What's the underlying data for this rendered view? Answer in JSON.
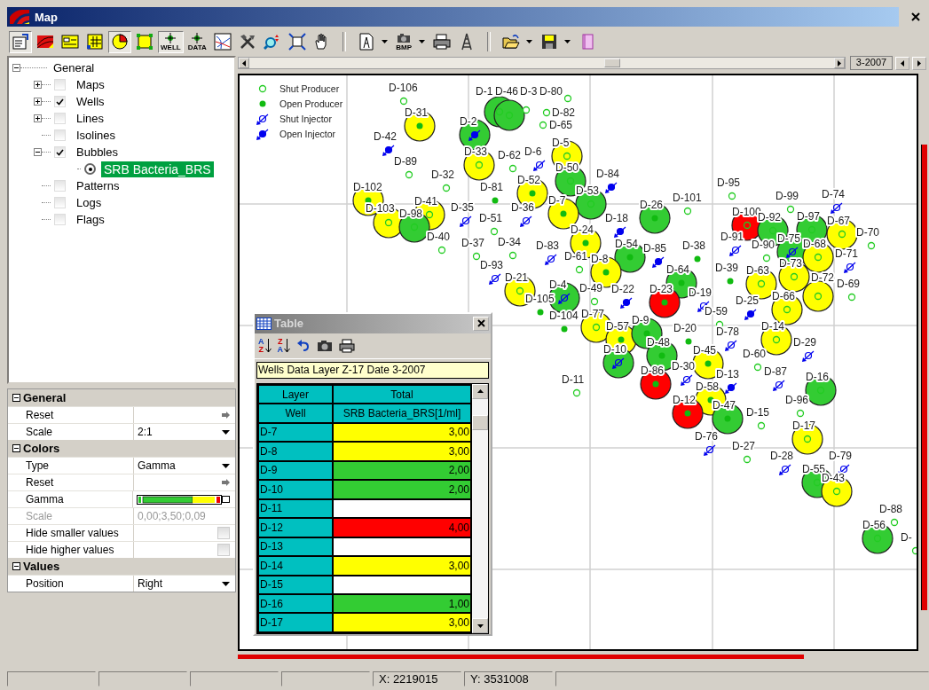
{
  "window": {
    "title": "Map"
  },
  "toolbar": {
    "groups": [
      {
        "buttons": [
          {
            "kind": "properties",
            "pressed": true,
            "menu": false
          },
          {
            "kind": "map-layers",
            "pressed": false,
            "menu": false
          },
          {
            "kind": "legend",
            "pressed": false,
            "menu": false
          },
          {
            "kind": "grid",
            "pressed": false,
            "menu": false
          },
          {
            "kind": "pie",
            "pressed": true,
            "menu": false
          },
          {
            "kind": "select",
            "pressed": false,
            "menu": false
          },
          {
            "kind": "well",
            "label": "WELL",
            "pressed": true,
            "menu": false
          },
          {
            "kind": "data",
            "label": "DATA",
            "pressed": false,
            "menu": false
          },
          {
            "kind": "crossplot",
            "pressed": false,
            "menu": false
          },
          {
            "kind": "tools",
            "pressed": false,
            "menu": false
          },
          {
            "kind": "zoom",
            "pressed": false,
            "menu": false
          },
          {
            "kind": "fit",
            "pressed": false,
            "menu": false
          },
          {
            "kind": "pan",
            "pressed": false,
            "menu": false
          }
        ]
      },
      {
        "buttons": [
          {
            "kind": "document",
            "pressed": false,
            "menu": true
          },
          {
            "kind": "bmp",
            "label": "BMP",
            "pressed": false,
            "menu": true
          },
          {
            "kind": "print",
            "pressed": false,
            "menu": false
          },
          {
            "kind": "rig",
            "pressed": false,
            "menu": false
          }
        ]
      },
      {
        "buttons": [
          {
            "kind": "open",
            "pressed": false,
            "menu": true
          },
          {
            "kind": "save",
            "pressed": false,
            "menu": true
          },
          {
            "kind": "book",
            "pressed": false,
            "menu": false
          }
        ]
      }
    ]
  },
  "tree": {
    "label": "General",
    "expanded": true,
    "children": [
      {
        "label": "Maps",
        "kind": "checkbox",
        "checked": false,
        "expanded": false
      },
      {
        "label": "Wells",
        "kind": "checkbox",
        "checked": true,
        "expanded": false
      },
      {
        "label": "Lines",
        "kind": "checkbox",
        "checked": false,
        "expanded": false
      },
      {
        "label": "Isolines",
        "kind": "checkbox",
        "checked": false
      },
      {
        "label": "Bubbles",
        "kind": "checkbox",
        "checked": true,
        "expanded": true,
        "children": [
          {
            "label": "SRB Bacteria_BRS",
            "kind": "radio",
            "selected": true
          }
        ]
      },
      {
        "label": "Patterns",
        "kind": "checkbox",
        "checked": false
      },
      {
        "label": "Logs",
        "kind": "checkbox",
        "checked": false
      },
      {
        "label": "Flags",
        "kind": "checkbox",
        "checked": false
      }
    ]
  },
  "properties": [
    {
      "title": "General",
      "expanded": true,
      "rows": [
        {
          "name": "Reset",
          "kind": "action",
          "disabled": false
        },
        {
          "name": "Scale",
          "kind": "dropdown",
          "value": "2:1",
          "disabled": false
        }
      ]
    },
    {
      "title": "Colors",
      "expanded": true,
      "rows": [
        {
          "name": "Type",
          "kind": "dropdown",
          "value": "Gamma",
          "disabled": false
        },
        {
          "name": "Reset",
          "kind": "action",
          "disabled": false
        },
        {
          "name": "Gamma",
          "kind": "gamma",
          "disabled": false
        },
        {
          "name": "Scale",
          "kind": "text",
          "value": "0,00;3,50;0,09",
          "disabled": true
        },
        {
          "name": "Hide smaller values",
          "kind": "checkbox",
          "checked": false,
          "disabled": false
        },
        {
          "name": "Hide higher values",
          "kind": "checkbox",
          "checked": false,
          "disabled": false
        }
      ]
    },
    {
      "title": "Values",
      "expanded": true,
      "rows": [
        {
          "name": "Position",
          "kind": "dropdown",
          "value": "Right",
          "disabled": false
        }
      ]
    }
  ],
  "date_field": "3-2007",
  "map": {
    "legend": [
      {
        "kind": "shut-producer",
        "label": "Shut Producer"
      },
      {
        "kind": "open-producer",
        "label": "Open Producer"
      },
      {
        "kind": "shut-injector",
        "label": "Shut Injector"
      },
      {
        "kind": "open-injector",
        "label": "Open Injector"
      }
    ],
    "wells": [
      {
        "label": "D-106",
        "kind": "shut-producer"
      },
      {
        "label": "D-31",
        "kind": "open-producer",
        "color": "#ffff00"
      },
      {
        "label": "D-1",
        "kind": "shut-producer",
        "color": "#33cc33"
      },
      {
        "label": "D-46",
        "kind": "shut-producer",
        "color": "#33cc33"
      },
      {
        "label": "D-3",
        "kind": "shut-producer"
      },
      {
        "label": "D-80",
        "kind": "shut-producer"
      },
      {
        "label": "D-82",
        "kind": "shut-producer"
      },
      {
        "label": "D-65",
        "kind": "shut-producer"
      },
      {
        "label": "D-42",
        "kind": "open-injector"
      },
      {
        "label": "D-2",
        "kind": "open-injector",
        "color": "#33cc33"
      },
      {
        "label": "D-33",
        "kind": "shut-producer",
        "color": "#ffff00"
      },
      {
        "label": "D-89",
        "kind": "shut-producer"
      },
      {
        "label": "D-62",
        "kind": "shut-producer"
      },
      {
        "label": "D-6",
        "kind": "shut-injector"
      },
      {
        "label": "D-5",
        "kind": "shut-producer",
        "color": "#ffff00"
      },
      {
        "label": "D-84",
        "kind": "open-injector"
      },
      {
        "label": "D-32",
        "kind": "shut-producer"
      },
      {
        "label": "D-81",
        "kind": "open-producer"
      },
      {
        "label": "D-50",
        "kind": "shut-producer",
        "color": "#33cc33"
      },
      {
        "label": "D-52",
        "kind": "open-producer",
        "color": "#ffff00"
      },
      {
        "label": "D-53",
        "kind": "shut-producer",
        "color": "#33cc33"
      },
      {
        "label": "D-102",
        "kind": "open-producer",
        "color": "#ffff00"
      },
      {
        "label": "D-103",
        "kind": "shut-producer",
        "color": "#ffff00"
      },
      {
        "label": "D-41",
        "kind": "shut-producer",
        "color": "#ffff00"
      },
      {
        "label": "D-98",
        "kind": "shut-producer",
        "color": "#33cc33"
      },
      {
        "label": "D-35",
        "kind": "shut-injector"
      },
      {
        "label": "D-36",
        "kind": "shut-injector"
      },
      {
        "label": "D-7",
        "kind": "open-producer",
        "color": "#ffff00"
      },
      {
        "label": "D-26",
        "kind": "open-producer",
        "color": "#33cc33"
      },
      {
        "label": "D-101",
        "kind": "shut-producer"
      },
      {
        "label": "D-95",
        "kind": "shut-producer"
      },
      {
        "label": "D-99",
        "kind": "shut-producer"
      },
      {
        "label": "D-74",
        "kind": "shut-injector"
      },
      {
        "label": "D-51",
        "kind": "shut-producer"
      },
      {
        "label": "D-18",
        "kind": "open-injector"
      },
      {
        "label": "D-100",
        "kind": "shut-producer",
        "color": "#ff0000"
      },
      {
        "label": "D-92",
        "kind": "shut-producer",
        "color": "#33cc33"
      },
      {
        "label": "D-97",
        "kind": "shut-producer",
        "color": "#33cc33"
      },
      {
        "label": "D-67",
        "kind": "shut-producer",
        "color": "#ffff00"
      },
      {
        "label": "D-70",
        "kind": "shut-producer"
      },
      {
        "label": "D-40",
        "kind": "shut-producer"
      },
      {
        "label": "D-37",
        "kind": "shut-producer"
      },
      {
        "label": "D-34",
        "kind": "shut-producer"
      },
      {
        "label": "D-24",
        "kind": "open-producer",
        "color": "#ffff00"
      },
      {
        "label": "D-54",
        "kind": "open-producer",
        "color": "#33cc33"
      },
      {
        "label": "D-85",
        "kind": "open-injector"
      },
      {
        "label": "D-38",
        "kind": "open-producer"
      },
      {
        "label": "D-91",
        "kind": "shut-injector"
      },
      {
        "label": "D-90",
        "kind": "shut-producer"
      },
      {
        "label": "D-75",
        "kind": "shut-injector",
        "color": "#33cc33"
      },
      {
        "label": "D-68",
        "kind": "shut-producer",
        "color": "#ffff00"
      },
      {
        "label": "D-71",
        "kind": "shut-injector"
      },
      {
        "label": "D-93",
        "kind": "shut-injector"
      },
      {
        "label": "D-83",
        "kind": "shut-injector"
      },
      {
        "label": "D-61",
        "kind": "shut-producer"
      },
      {
        "label": "D-8",
        "kind": "open-producer",
        "color": "#ffff00"
      },
      {
        "label": "D-64",
        "kind": "open-producer",
        "color": "#33cc33"
      },
      {
        "label": "D-39",
        "kind": "open-producer"
      },
      {
        "label": "D-63",
        "kind": "shut-producer",
        "color": "#ffff00"
      },
      {
        "label": "D-73",
        "kind": "shut-producer",
        "color": "#ffff00"
      },
      {
        "label": "D-72",
        "kind": "shut-producer",
        "color": "#ffff00"
      },
      {
        "label": "D-69",
        "kind": "shut-producer"
      },
      {
        "label": "D-21",
        "kind": "shut-producer",
        "color": "#ffff00"
      },
      {
        "label": "D-4",
        "kind": "shut-injector",
        "color": "#33cc33"
      },
      {
        "label": "D-105",
        "kind": "open-producer"
      },
      {
        "label": "D-49",
        "kind": "shut-producer"
      },
      {
        "label": "D-22",
        "kind": "open-injector"
      },
      {
        "label": "D-23",
        "kind": "open-producer",
        "color": "#ff0000"
      },
      {
        "label": "D-19",
        "kind": "shut-injector"
      },
      {
        "label": "D-25",
        "kind": "open-injector"
      },
      {
        "label": "D-66",
        "kind": "shut-producer",
        "color": "#ffff00"
      },
      {
        "label": "D-104",
        "kind": "open-producer"
      },
      {
        "label": "D-77",
        "kind": "shut-producer",
        "color": "#ffff00"
      },
      {
        "label": "D-57",
        "kind": "open-producer",
        "color": "#ffff00"
      },
      {
        "label": "D-9",
        "kind": "open-producer",
        "color": "#33cc33"
      },
      {
        "label": "D-59",
        "kind": "shut-producer"
      },
      {
        "label": "D-20",
        "kind": "open-producer"
      },
      {
        "label": "D-78",
        "kind": "shut-injector"
      },
      {
        "label": "D-14",
        "kind": "shut-producer",
        "color": "#ffff00"
      },
      {
        "label": "D-10",
        "kind": "shut-injector",
        "color": "#33cc33"
      },
      {
        "label": "D-48",
        "kind": "open-producer",
        "color": "#33cc33"
      },
      {
        "label": "D-45",
        "kind": "open-producer",
        "color": "#ffff00"
      },
      {
        "label": "D-60",
        "kind": "shut-producer"
      },
      {
        "label": "D-29",
        "kind": "shut-injector"
      },
      {
        "label": "D-30",
        "kind": "shut-injector"
      },
      {
        "label": "D-86",
        "kind": "open-producer",
        "color": "#ff0000"
      },
      {
        "label": "D-13",
        "kind": "open-injector"
      },
      {
        "label": "D-87",
        "kind": "shut-injector"
      },
      {
        "label": "D-11",
        "kind": "shut-producer"
      },
      {
        "label": "D-16",
        "kind": "shut-producer",
        "color": "#33cc33"
      },
      {
        "label": "D-58",
        "kind": "open-producer",
        "color": "#ffff00"
      },
      {
        "label": "D-96",
        "kind": "shut-producer"
      },
      {
        "label": "D-12",
        "kind": "open-producer",
        "color": "#ff0000"
      },
      {
        "label": "D-47",
        "kind": "open-producer",
        "color": "#33cc33"
      },
      {
        "label": "D-15",
        "kind": "shut-producer"
      },
      {
        "label": "D-17",
        "kind": "shut-producer",
        "color": "#ffff00"
      },
      {
        "label": "D-76",
        "kind": "shut-injector"
      },
      {
        "label": "D-27",
        "kind": "shut-producer"
      },
      {
        "label": "D-28",
        "kind": "shut-injector"
      },
      {
        "label": "D-79",
        "kind": "shut-injector"
      },
      {
        "label": "D-55",
        "kind": "shut-producer",
        "color": "#33cc33"
      },
      {
        "label": "D-43",
        "kind": "shut-producer",
        "color": "#ffff00"
      },
      {
        "label": "D-88",
        "kind": "shut-producer"
      },
      {
        "label": "D-56",
        "kind": "shut-producer",
        "color": "#33cc33"
      },
      {
        "label": "D-",
        "kind": "shut-producer"
      }
    ]
  },
  "table_window": {
    "title": "Table",
    "tools": [
      {
        "kind": "sort-ascending",
        "top": "A",
        "bottom": "Z"
      },
      {
        "kind": "sort-descending",
        "top": "Z",
        "bottom": "A"
      },
      {
        "kind": "undo"
      },
      {
        "kind": "camera"
      },
      {
        "kind": "print"
      }
    ],
    "caption": "Wells Data Layer Z-17 Date 3-2007",
    "header": [
      [
        "Layer",
        "Total"
      ],
      [
        "Well",
        "SRB Bacteria_BRS[1/ml]"
      ]
    ],
    "rows": [
      {
        "well": "D-7",
        "value": "3,00",
        "color": "#ffff00"
      },
      {
        "well": "D-8",
        "value": "3,00",
        "color": "#ffff00"
      },
      {
        "well": "D-9",
        "value": "2,00",
        "color": "#33cc33"
      },
      {
        "well": "D-10",
        "value": "2,00",
        "color": "#33cc33"
      },
      {
        "well": "D-11",
        "color": "#ffffff"
      },
      {
        "well": "D-12",
        "value": "4,00",
        "color": "#ff0000"
      },
      {
        "well": "D-13",
        "color": "#ffffff"
      },
      {
        "well": "D-14",
        "value": "3,00",
        "color": "#ffff00"
      },
      {
        "well": "D-15",
        "color": "#ffffff"
      },
      {
        "well": "D-16",
        "value": "1,00",
        "color": "#33cc33"
      },
      {
        "well": "D-17",
        "value": "3,00",
        "color": "#ffff00"
      }
    ]
  },
  "status_bar": {
    "x": "X: 2219015",
    "y": "Y: 3531008"
  }
}
